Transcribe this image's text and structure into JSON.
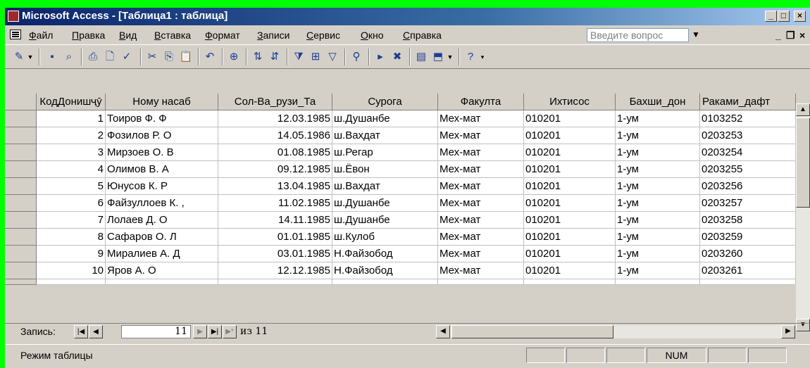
{
  "window": {
    "title": "Microsoft Access - [Таблица1 : таблица]"
  },
  "menu": {
    "items": [
      "Файл",
      "Правка",
      "Вид",
      "Вставка",
      "Формат",
      "Записи",
      "Сервис",
      "Окно",
      "Справка"
    ],
    "ask_placeholder": "Введите вопрос"
  },
  "table": {
    "columns": [
      "КодДонишҷӯ",
      "Ному насаб",
      "Сол-Ва_рузи_Та",
      "Сурога",
      "Факулта",
      "Ихтисос",
      "Бахши_дон",
      "Раками_дафт"
    ],
    "rows": [
      [
        "1",
        "Тоиров Ф. Ф",
        "12.03.1985",
        "ш.Душанбе",
        "Мех-мат",
        "010201",
        "1-ум",
        "0103252"
      ],
      [
        "2",
        "Фозилов Р. О",
        "14.05.1986",
        "ш.Вахдат",
        "Мех-мат",
        "010201",
        "1-ум",
        "0203253"
      ],
      [
        "3",
        "Мирзоев О. В",
        "01.08.1985",
        "ш.Регар",
        "Мех-мат",
        "010201",
        "1-ум",
        "0203254"
      ],
      [
        "4",
        "Олимов В. А",
        "09.12.1985",
        "ш.Ёвон",
        "Мех-мат",
        "010201",
        "1-ум",
        "0203255"
      ],
      [
        "5",
        "Юнусов К. Р",
        "13.04.1985",
        "ш.Вахдат",
        "Мех-мат",
        "010201",
        "1-ум",
        "0203256"
      ],
      [
        "6",
        "Файзуллоев К. ,",
        "11.02.1985",
        "ш.Душанбе",
        "Мех-мат",
        "010201",
        "1-ум",
        "0203257"
      ],
      [
        "7",
        "Лолаев Д. О",
        "14.11.1985",
        "ш.Душанбе",
        "Мех-мат",
        "010201",
        "1-ум",
        "0203258"
      ],
      [
        "8",
        "Сафаров О. Л",
        "01.01.1985",
        "ш.Кулоб",
        "Мех-мат",
        "010201",
        "1-ум",
        "0203259"
      ],
      [
        "9",
        "Миралиев А. Д",
        "03.01.1985",
        "Н.Файзобод",
        "Мех-мат",
        "010201",
        "1-ум",
        "0203260"
      ],
      [
        "10",
        "Яров А. О",
        "12.12.1985",
        "Н.Файзобод",
        "Мех-мат",
        "010201",
        "1-ум",
        "0203261"
      ]
    ]
  },
  "navigation": {
    "label": "Запись:",
    "current": "11",
    "of_label": "из 11"
  },
  "status": {
    "text": "Режим таблицы",
    "num": "NUM"
  },
  "colors": {
    "background": "#00ff00",
    "titlebar": "#0a246a",
    "face": "#d4d0c8"
  }
}
